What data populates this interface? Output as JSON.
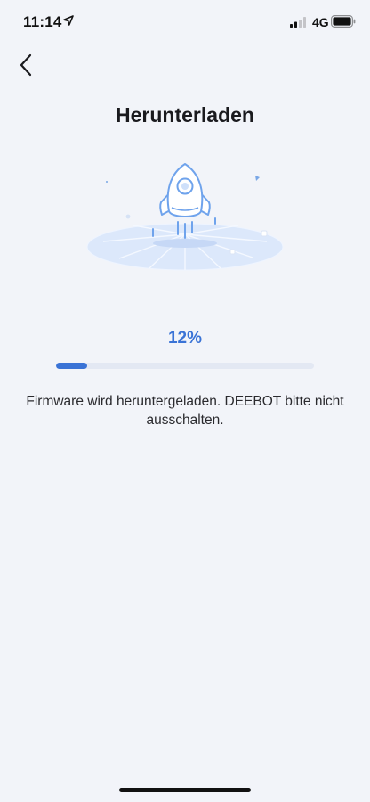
{
  "status_bar": {
    "time": "11:14",
    "network": "4G",
    "location_icon": "location-arrow-icon",
    "signal_icon": "cellular-signal-icon",
    "battery_icon": "battery-icon"
  },
  "nav": {
    "back_icon": "chevron-left-icon"
  },
  "page": {
    "title": "Herunterladen"
  },
  "illustration": {
    "icon": "rocket-icon"
  },
  "progress": {
    "percent_label": "12%",
    "value": 0.12,
    "color": "#3a73d6",
    "track_color": "#e3e8f3"
  },
  "message": "Firmware wird heruntergeladen. DEEBOT bitte nicht ausschalten."
}
